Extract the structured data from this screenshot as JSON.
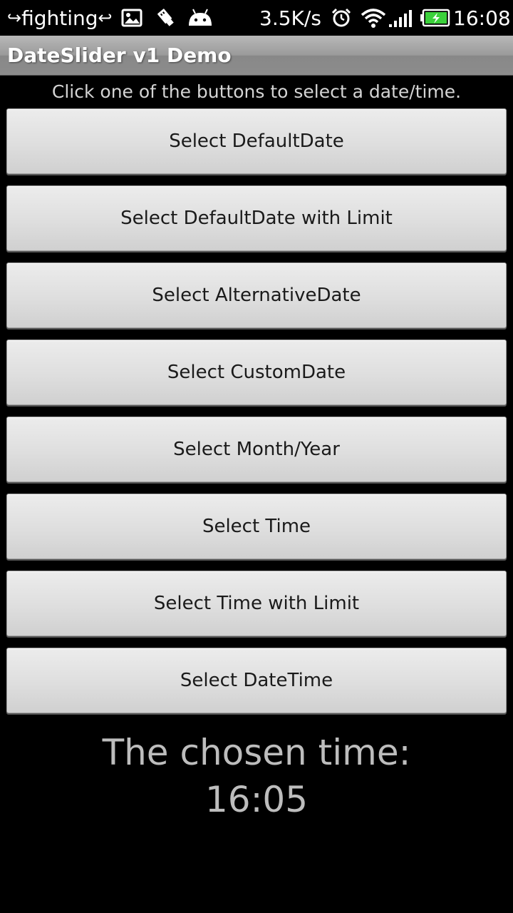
{
  "status_bar": {
    "left_prefix_arrow": "↪",
    "left_text": "fighting",
    "left_suffix_arrow": "↩",
    "icons": [
      "image-icon",
      "usb-icon",
      "android-icon",
      "alarm-icon",
      "wifi-icon",
      "signal-icon",
      "battery-icon"
    ],
    "network_speed": "3.5K/s",
    "time": "16:08",
    "battery_color": "#3bd13b"
  },
  "app": {
    "title": "DateSlider v1 Demo"
  },
  "main": {
    "instruction": "Click one of the buttons to select a date/time.",
    "buttons": [
      {
        "label": "Select DefaultDate"
      },
      {
        "label": "Select DefaultDate with Limit"
      },
      {
        "label": "Select AlternativeDate"
      },
      {
        "label": "Select CustomDate"
      },
      {
        "label": "Select Month/Year"
      },
      {
        "label": "Select Time"
      },
      {
        "label": "Select Time with Limit"
      },
      {
        "label": "Select DateTime"
      }
    ],
    "result_label": "The chosen time:",
    "result_value": "16:05"
  }
}
